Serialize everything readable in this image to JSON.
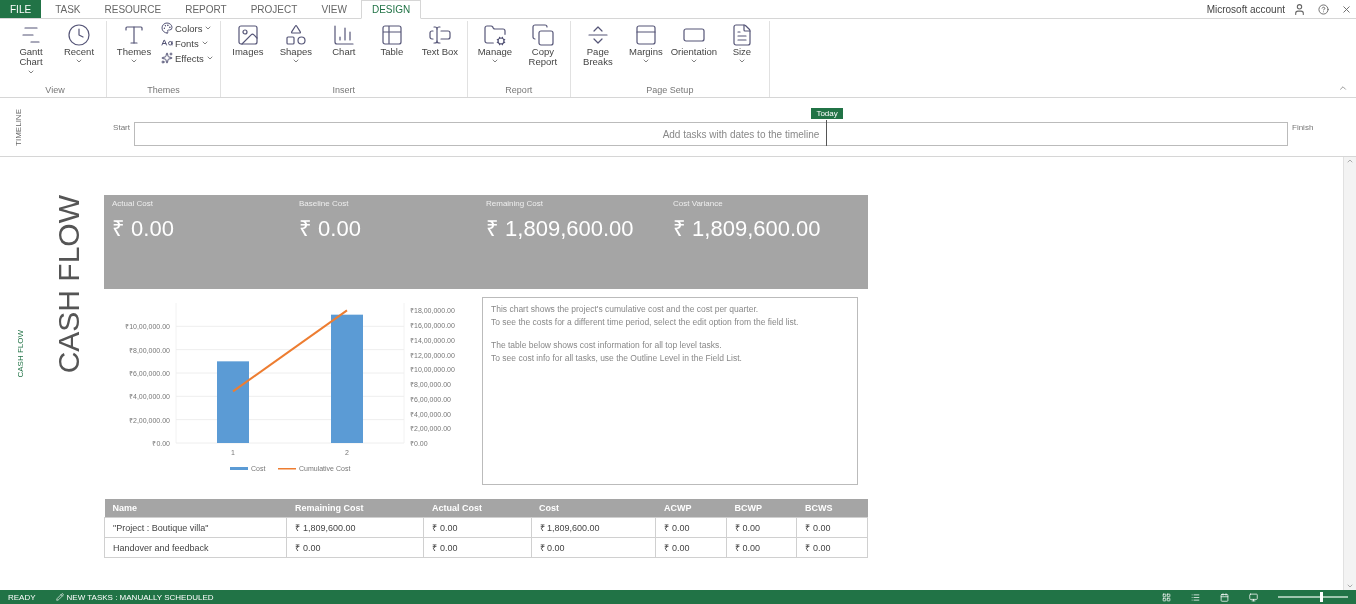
{
  "tabs": [
    {
      "label": "FILE",
      "kind": "file",
      "selected": false
    },
    {
      "label": "TASK",
      "kind": "tab",
      "selected": false
    },
    {
      "label": "RESOURCE",
      "kind": "tab",
      "selected": false
    },
    {
      "label": "REPORT",
      "kind": "tab",
      "selected": false
    },
    {
      "label": "PROJECT",
      "kind": "tab",
      "selected": false
    },
    {
      "label": "VIEW",
      "kind": "tab",
      "selected": false
    },
    {
      "label": "DESIGN",
      "kind": "tab",
      "selected": true
    }
  ],
  "account": {
    "label": "Microsoft account"
  },
  "ribbon": [
    {
      "label": "View",
      "buttons": [
        {
          "label": "Gantt Chart",
          "kind": "large",
          "dropdown": true
        },
        {
          "label": "Recent",
          "kind": "large",
          "dropdown": true
        }
      ]
    },
    {
      "label": "Themes",
      "buttons": [
        {
          "label": "Themes",
          "kind": "large",
          "dropdown": true
        },
        {
          "label": "Colors",
          "kind": "small",
          "dropdown": true
        },
        {
          "label": "Fonts",
          "kind": "small",
          "dropdown": true
        },
        {
          "label": "Effects",
          "kind": "small",
          "dropdown": true
        }
      ]
    },
    {
      "label": "Insert",
      "buttons": [
        {
          "label": "Images",
          "kind": "large",
          "dropdown": false
        },
        {
          "label": "Shapes",
          "kind": "large",
          "dropdown": true
        },
        {
          "label": "Chart",
          "kind": "large",
          "dropdown": false
        },
        {
          "label": "Table",
          "kind": "large",
          "dropdown": false
        },
        {
          "label": "Text Box",
          "kind": "large",
          "dropdown": false
        }
      ]
    },
    {
      "label": "Report",
      "buttons": [
        {
          "label": "Manage",
          "kind": "large",
          "dropdown": true
        },
        {
          "label": "Copy Report",
          "kind": "large",
          "dropdown": false
        }
      ]
    },
    {
      "label": "Page Setup",
      "buttons": [
        {
          "label": "Page Breaks",
          "kind": "large",
          "dropdown": false
        },
        {
          "label": "Margins",
          "kind": "large",
          "dropdown": true
        },
        {
          "label": "Orientation",
          "kind": "large",
          "dropdown": true
        },
        {
          "label": "Size",
          "kind": "large",
          "dropdown": true
        }
      ]
    }
  ],
  "timeline": {
    "title": "TIMELINE",
    "start": "Start",
    "finish": "Finish",
    "today": "Today",
    "hint": "Add tasks with dates to the timeline"
  },
  "sidebar": {
    "label": "CASH FLOW"
  },
  "report": {
    "title": "CASH FLOW",
    "tiles": [
      {
        "label": "Actual Cost",
        "value": "₹ 0.00"
      },
      {
        "label": "Baseline Cost",
        "value": "₹ 0.00"
      },
      {
        "label": "Remaining Cost",
        "value": "₹ 1,809,600.00"
      },
      {
        "label": "Cost Variance",
        "value": "₹ 1,809,600.00"
      }
    ],
    "chart_data": {
      "type": "bar",
      "categories": [
        "1",
        "2"
      ],
      "series": [
        {
          "name": "Cost",
          "type": "bar",
          "color": "#5b9bd5",
          "values": [
            700000,
            1100000
          ]
        },
        {
          "name": "Cumulative Cost",
          "type": "line",
          "color": "#ed7d31",
          "axis": "y2",
          "values": [
            700000,
            1800000
          ]
        }
      ],
      "stacked": false,
      "grid": true,
      "legend": "bottom",
      "ylim": [
        0,
        1200000
      ],
      "y2lim": [
        0,
        1900000
      ],
      "yticks": [
        {
          "value": 0,
          "label": "₹0.00"
        },
        {
          "value": 200000,
          "label": "₹2,00,000.00"
        },
        {
          "value": 400000,
          "label": "₹4,00,000.00"
        },
        {
          "value": 600000,
          "label": "₹6,00,000.00"
        },
        {
          "value": 800000,
          "label": "₹8,00,000.00"
        },
        {
          "value": 1000000,
          "label": "₹10,00,000.00"
        }
      ],
      "y2ticks": [
        {
          "value": 0,
          "label": "₹0.00"
        },
        {
          "value": 200000,
          "label": "₹2,00,000.00"
        },
        {
          "value": 400000,
          "label": "₹4,00,000.00"
        },
        {
          "value": 600000,
          "label": "₹6,00,000.00"
        },
        {
          "value": 800000,
          "label": "₹8,00,000.00"
        },
        {
          "value": 1000000,
          "label": "₹10,00,000.00"
        },
        {
          "value": 1200000,
          "label": "₹12,00,000.00"
        },
        {
          "value": 1400000,
          "label": "₹14,00,000.00"
        },
        {
          "value": 1600000,
          "label": "₹16,00,000.00"
        },
        {
          "value": 1800000,
          "label": "₹18,00,000.00"
        }
      ]
    },
    "notes": [
      "This chart shows the project's cumulative cost and the cost per quarter.",
      "To see the costs for a different time period, select the edit option from the field list.",
      "The table below shows cost information for all top level tasks.",
      "To see cost info for all tasks, use the Outline Level in the Field List."
    ],
    "table": {
      "columns": [
        "Name",
        "Remaining Cost",
        "Actual Cost",
        "Cost",
        "ACWP",
        "BCWP",
        "BCWS"
      ],
      "rows": [
        [
          "\"Project : Boutique villa\"",
          "₹ 1,809,600.00",
          "₹ 0.00",
          "₹ 1,809,600.00",
          "₹ 0.00",
          "₹ 0.00",
          "₹ 0.00"
        ],
        [
          "Handover and feedback",
          "₹ 0.00",
          "₹ 0.00",
          "₹ 0.00",
          "₹ 0.00",
          "₹ 0.00",
          "₹ 0.00"
        ]
      ]
    }
  },
  "status_bar": {
    "ready": "READY",
    "mode": "NEW TASKS : MANUALLY SCHEDULED",
    "zoom": {
      "level": 0.6
    }
  }
}
